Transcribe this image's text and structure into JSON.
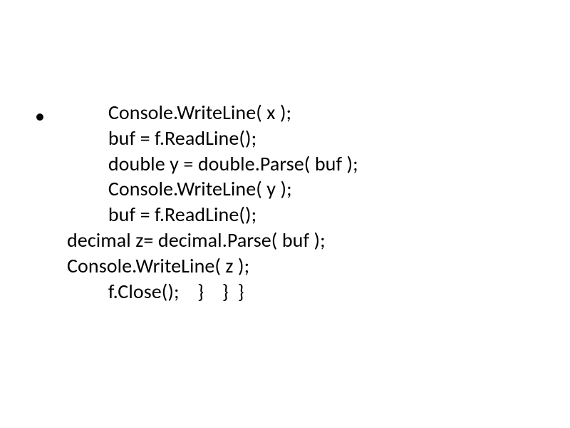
{
  "bullet": "•",
  "code": {
    "l1": "         Console.WriteLine( x );",
    "l2": "         buf = f.ReadLine();",
    "l3": "         double y = double.Parse( buf );",
    "l4": "         Console.WriteLine( y );",
    "l5": "         buf = f.ReadLine();",
    "l6": "decimal z= decimal.Parse( buf );",
    "l7": "Console.WriteLine( z );",
    "l8": "         f.Close();    }    }  }"
  }
}
